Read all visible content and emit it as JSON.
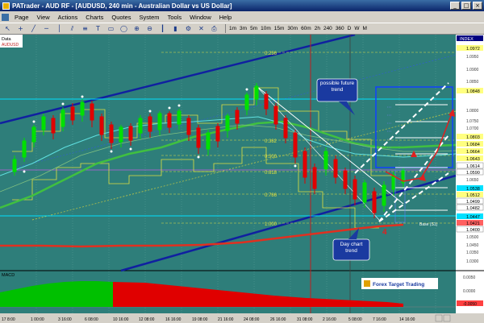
{
  "window": {
    "title": "PATrader - AUD RF - [AUDUSD, 240 min - Australian Dollar vs US Dollar]"
  },
  "menu": [
    "Page",
    "View",
    "Actions",
    "Charts",
    "Quotes",
    "System",
    "Tools",
    "Window",
    "Help"
  ],
  "timeframes": [
    "1m",
    "3m",
    "5m",
    "10m",
    "15m",
    "30m",
    "60m",
    "2h",
    "240",
    "360",
    "D",
    "W",
    "M"
  ],
  "chart": {
    "label_data": "Data",
    "label_symbol": "AUDUSD",
    "fib_labels": [
      "0.382",
      "0.500",
      "0.618",
      "0.786",
      "1.000",
      "0.236"
    ],
    "price_tags": [
      "1.0972",
      "1.0848",
      "1.0803",
      "1.0684",
      "1.0664",
      "1.0643",
      "1.0614",
      "1.0590",
      "1.0538",
      "1.0512",
      "1.0499",
      "1.0482",
      "1.0447",
      "1.0421",
      "1.0400"
    ],
    "axis_prices": [
      "1.0950",
      "1.0900",
      "1.0850",
      "1.0800",
      "1.0750",
      "1.0700",
      "1.0650",
      "1.0500",
      "1.0450",
      "1.0350",
      "1.0300"
    ],
    "index_label": "INDEX",
    "annotation_future": "possible future trend",
    "annotation_day": "Day chart trend",
    "wave_label": "4",
    "base_label": "Base (S1)",
    "date_labels": [
      "17 8:00",
      "1 00:00",
      "3 16:00",
      "6 08:00",
      "10 16:00",
      "12 08:00",
      "16 16:00",
      "19 08:00",
      "21 16:00",
      "24 08:00",
      "26 16:00",
      "31 08:00",
      "2 16:00",
      "5 08:00",
      "7 16:00",
      "14 16:00"
    ],
    "macd_label": "MACD",
    "macd_axis": [
      "0.0050",
      "0.0000",
      "-0.0050"
    ],
    "logo_text": "Forex Target Trading"
  },
  "colors": {
    "background": "#2e7e7a",
    "bull": "#00e000",
    "bear": "#e00000",
    "trend": "#1020a0",
    "accent": "#ffff00"
  }
}
